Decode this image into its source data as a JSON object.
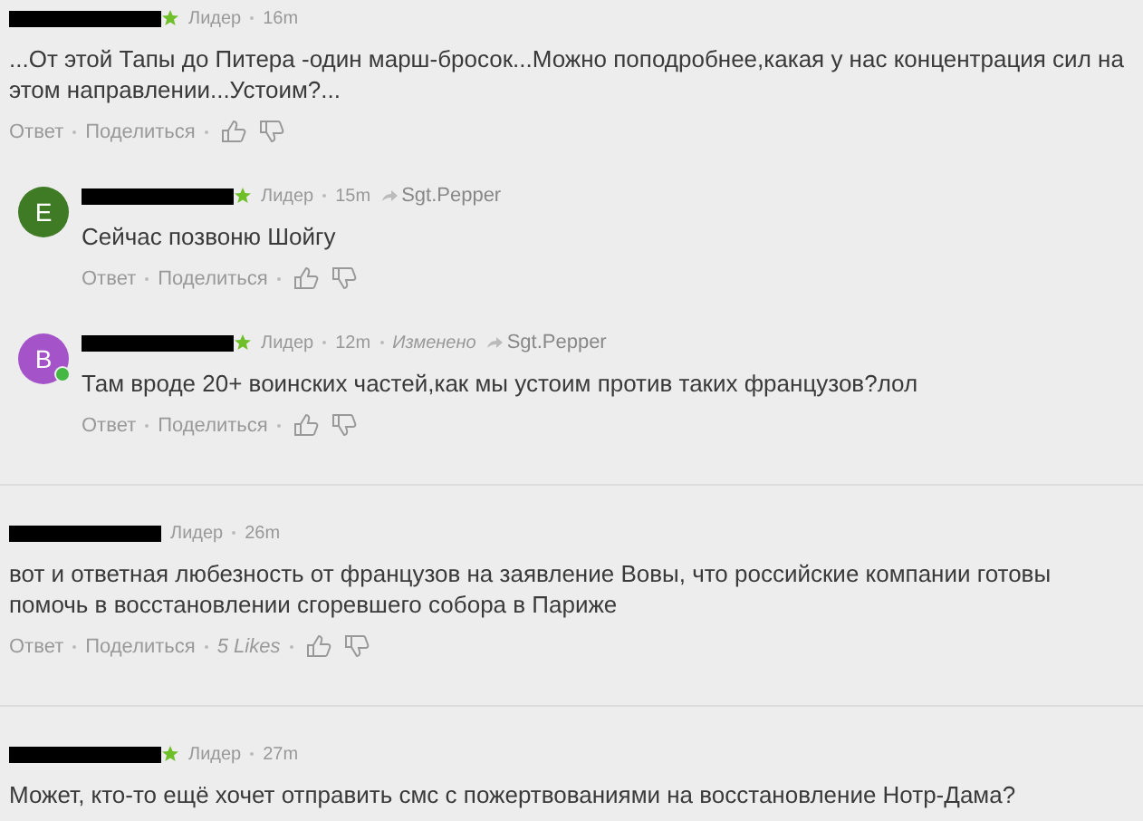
{
  "comments": [
    {
      "star": true,
      "role": "Лидер",
      "time": "16m",
      "text": "...От этой Тапы до Питера -один марш-бросок...Можно поподробнее,какая у нас концентрация сил на этом направлении...Устоим?...",
      "actions": [
        "Ответ",
        "Поделиться"
      ],
      "children": [
        {
          "avatar": {
            "letter": "E",
            "color": "#3f7a25",
            "online": false
          },
          "star": true,
          "role": "Лидер",
          "time": "15m",
          "reply_to": "Sgt.Pepper",
          "text": "Сейчас позвоню Шойгу",
          "actions": [
            "Ответ",
            "Поделиться"
          ]
        },
        {
          "avatar": {
            "letter": "B",
            "color": "#a453c9",
            "online": true
          },
          "star": true,
          "role": "Лидер",
          "time": "12m",
          "edited": "Изменено",
          "reply_to": "Sgt.Pepper",
          "text": "Там вроде  20+ воинских частей,как мы устоим против таких французов?лол",
          "actions": [
            "Ответ",
            "Поделиться"
          ]
        }
      ]
    },
    {
      "star": false,
      "role": "Лидер",
      "time": "26m",
      "text": "вот и ответная любезность от французов на заявление Вовы, что российские компании готовы помочь в восстановлении сгоревшего собора в Париже",
      "actions": [
        "Ответ",
        "Поделиться"
      ],
      "likes": "5 Likes"
    },
    {
      "star": true,
      "role": "Лидер",
      "time": "27m",
      "text": "Может, кто-то ещё хочет отправить смс с пожертвованиями на  восстановление Нотр-Дама?"
    }
  ]
}
